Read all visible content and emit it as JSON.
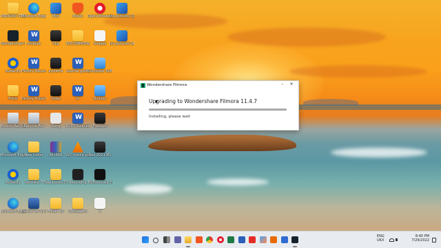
{
  "desktop": {
    "icons": [
      {
        "label": "ANDROID STUDIO",
        "glyph": "folder"
      },
      {
        "label": "Microsoft Edge",
        "glyph": "edge"
      },
      {
        "label": "Mini",
        "glyph": "img"
      },
      {
        "label": "Brave",
        "glyph": "brave"
      },
      {
        "label": "Opera Browser",
        "glyph": "opera"
      },
      {
        "label": "Ins pictures 10",
        "glyph": "img"
      },
      {
        "label": "Wondershare Filmora 11",
        "glyph": "filmora"
      },
      {
        "label": "untitled",
        "glyph": "word"
      },
      {
        "label": "Clip",
        "glyph": "video"
      },
      {
        "label": "ROCOMMONS",
        "glyph": "folder"
      },
      {
        "label": "Images",
        "glyph": "file"
      },
      {
        "label": "Ins pictures 04",
        "glyph": "img"
      },
      {
        "label": "Audacity",
        "glyph": "audacity"
      },
      {
        "label": "History Documen",
        "glyph": "word"
      },
      {
        "label": "systems",
        "glyph": "video"
      },
      {
        "label": "tutorial guide",
        "glyph": "word"
      },
      {
        "label": "Computer Soft",
        "glyph": "misc"
      },
      {
        "label": "Fotos",
        "glyph": "folder"
      },
      {
        "label": "History Project Wi...",
        "glyph": "word"
      },
      {
        "label": "Video",
        "glyph": "video"
      },
      {
        "label": "hr",
        "glyph": "word"
      },
      {
        "label": "Rudoko",
        "glyph": "misc"
      },
      {
        "label": "Macros Recycle",
        "glyph": "recycle"
      },
      {
        "label": "Recycle Bin",
        "glyph": "recycle"
      },
      {
        "label": "Song",
        "glyph": "pdf"
      },
      {
        "label": "NCRT Sources",
        "glyph": "word"
      },
      {
        "label": "Fieldays",
        "glyph": "video"
      },
      {
        "label": "Microsoft Edge",
        "glyph": "edge"
      },
      {
        "label": "New folder",
        "glyph": "folder"
      },
      {
        "label": "WinRAR",
        "glyph": "winrar"
      },
      {
        "label": "VLC media player",
        "glyph": "vlc"
      },
      {
        "label": "Dec 2021 ML",
        "glyph": "video"
      },
      {
        "label": "Audacity",
        "glyph": "audacity"
      },
      {
        "label": "idemsho 7",
        "glyph": "folder"
      },
      {
        "label": "Fake books 03",
        "glyph": "folder"
      },
      {
        "label": "Recording",
        "glyph": "dark"
      },
      {
        "label": "TikTok music HWM 09",
        "glyph": "tiktok"
      },
      {
        "label": "Microsoft Edge",
        "glyph": "edge"
      },
      {
        "label": "Oracle VM VirtualBox",
        "glyph": "vbox"
      },
      {
        "label": "Folder 10",
        "glyph": "folder"
      },
      {
        "label": "Wallpapers",
        "glyph": "folder"
      },
      {
        "label": "4",
        "glyph": "file"
      }
    ]
  },
  "dialog": {
    "title": "Wondershare Filmora",
    "minimize_label": "–",
    "close_label": "✕",
    "heading": "Upgrading to Wondershare Filmora 11.4.7",
    "status": "Installing, please wait",
    "progress_fraction": 1.0
  },
  "taskbar": {
    "apps": [
      "start-icon",
      "search-icon",
      "task-view-icon",
      "chat-icon",
      "file-explorer-icon",
      "brave-icon",
      "chrome-icon",
      "opera-icon",
      "excel-icon",
      "word-icon",
      "youtube-icon",
      "photos-icon",
      "vlc-icon",
      "store-icon",
      "filmora-icon"
    ],
    "language_top": "ENG",
    "language_bottom": "UKX",
    "time": "8:40 PM",
    "date": "7/29/2022"
  }
}
